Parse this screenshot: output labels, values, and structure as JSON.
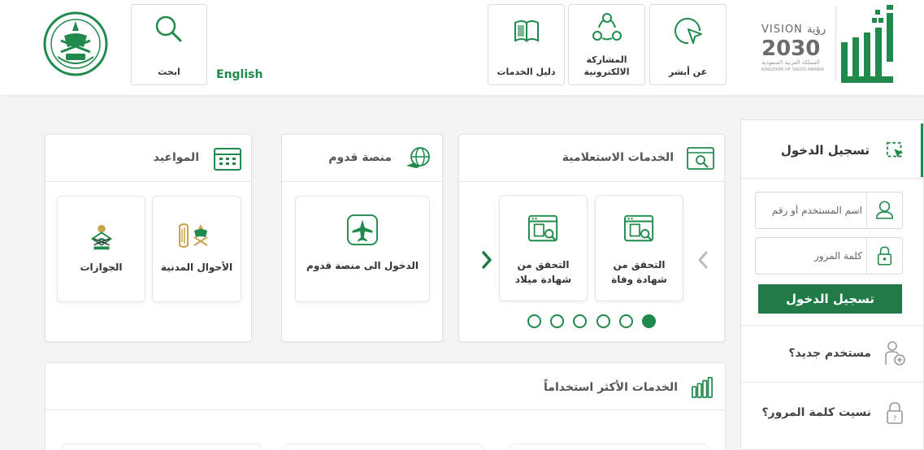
{
  "header": {
    "english_label": "English",
    "search_label": "ابحث",
    "nav": {
      "services_guide": "دليل الخدمات",
      "e_participation_line1": "المشاركة",
      "e_participation_line2": "الالكترونية",
      "about_absher": "عن أبشر"
    }
  },
  "inquiry": {
    "title": "الخدمات الاستعلامية",
    "tiles": [
      {
        "line1": "التحقق من",
        "line2": "شهادة وفاة"
      },
      {
        "line1": "التحقق من",
        "line2": "شهادة ميلاد"
      }
    ],
    "dots_count": 6,
    "active_dot": 1
  },
  "qudoom": {
    "title": "منصة قدوم",
    "tile_label": "الدخول الى منصة قدوم"
  },
  "appointments": {
    "title": "المواعيد",
    "tiles": [
      {
        "label": "الأحوال المدنية"
      },
      {
        "label": "الجوازات"
      }
    ]
  },
  "login": {
    "title": "تسجيل الدخول",
    "username_placeholder": "اسم المستخدم أو رقم",
    "password_placeholder": "كلمة المرور",
    "submit_label": "تسجيل الدخول",
    "new_user": "مستخدم جديد؟",
    "forgot_password": "نسيت كلمة المرور؟"
  },
  "most_used": {
    "title": "الخدمات الأكثر استخداماً"
  },
  "colors": {
    "brand_green": "#1f8a4c",
    "button_green": "#1f7a45",
    "gold": "#c9a24a"
  },
  "icons": {
    "search": "search-icon",
    "services_guide": "book-icon",
    "participation": "share-network-icon",
    "about": "cursor-click-icon",
    "login": "login-icon",
    "user": "user-icon",
    "lock": "lock-icon"
  }
}
